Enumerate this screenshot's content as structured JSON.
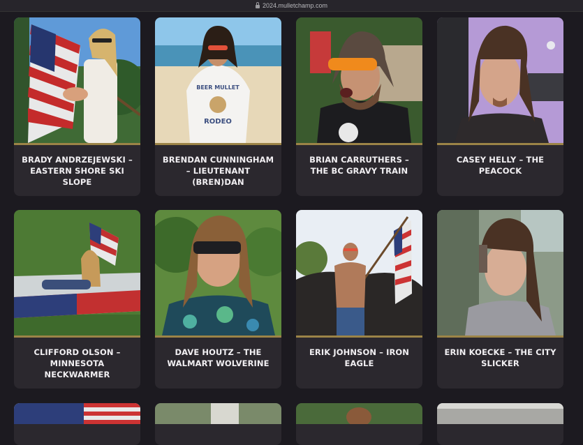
{
  "browser": {
    "url": "2024.mulletchamp.com"
  },
  "colors": {
    "page_bg": "#1c1a20",
    "card_bg": "#2b282e",
    "accent_line": "#9c8447",
    "text": "#f1eff2"
  },
  "contestants": [
    {
      "caption": "BRADY ANDRZEJEWSKI – EASTERN SHORE SKI SLOPE",
      "photo_text": ""
    },
    {
      "caption": "BRENDAN CUNNINGHAM – LIEUTENANT (BREN)DAN",
      "photo_text": "BEER MULLET RODEO"
    },
    {
      "caption": "BRIAN CARRUTHERS – THE BC GRAVY TRAIN",
      "photo_text": ""
    },
    {
      "caption": "CASEY HELLY – THE PEACOCK",
      "photo_text": ""
    },
    {
      "caption": "CLIFFORD OLSON – MINNESOTA NECKWARMER",
      "photo_text": ""
    },
    {
      "caption": "DAVE HOUTZ – THE WALMART WOLVERINE",
      "photo_text": ""
    },
    {
      "caption": "ERIK JOHNSON – IRON EAGLE",
      "photo_text": ""
    },
    {
      "caption": "ERIN KOECKE – THE CITY SLICKER",
      "photo_text": ""
    }
  ]
}
